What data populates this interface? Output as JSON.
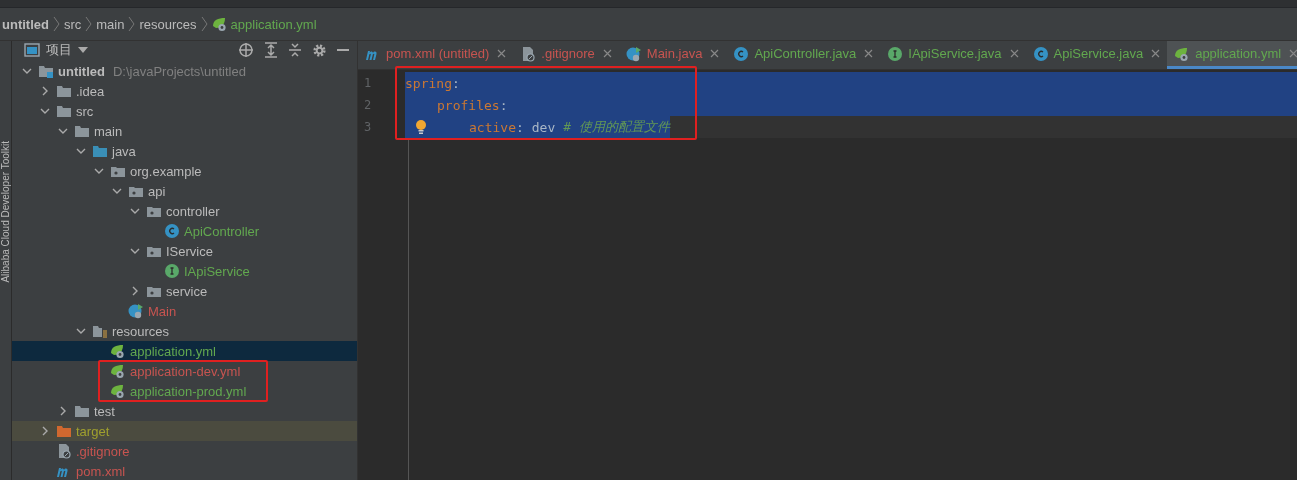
{
  "breadcrumb": [
    {
      "label": "untitled",
      "kind": "project"
    },
    {
      "label": "src",
      "kind": "folder"
    },
    {
      "label": "main",
      "kind": "folder"
    },
    {
      "label": "resources",
      "kind": "folder"
    },
    {
      "label": "application.yml",
      "kind": "spring-config"
    }
  ],
  "side_strip": {
    "label": "Alibaba Cloud Developer Toolkit"
  },
  "project_panel": {
    "title": "项目",
    "tree": [
      {
        "name": "untitled",
        "path": "D:\\javaProjects\\untitled",
        "kind": "module",
        "color": "#bbbbbb",
        "expanded": true,
        "selected": false,
        "children": [
          {
            "name": ".idea",
            "kind": "folder",
            "color": "#bbbbbb",
            "expanded": false,
            "selected": false
          },
          {
            "name": "src",
            "kind": "folder",
            "color": "#bbbbbb",
            "expanded": true,
            "selected": false,
            "children": [
              {
                "name": "main",
                "kind": "folder",
                "color": "#bbbbbb",
                "expanded": true,
                "selected": false,
                "children": [
                  {
                    "name": "java",
                    "kind": "source-folder",
                    "color": "#bbbbbb",
                    "expanded": true,
                    "selected": false,
                    "children": [
                      {
                        "name": "org.example",
                        "kind": "package",
                        "color": "#bbbbbb",
                        "expanded": true,
                        "selected": false,
                        "children": [
                          {
                            "name": "api",
                            "kind": "package",
                            "color": "#bbbbbb",
                            "expanded": true,
                            "selected": false,
                            "children": [
                              {
                                "name": "controller",
                                "kind": "package",
                                "color": "#bbbbbb",
                                "expanded": true,
                                "selected": false,
                                "children": [
                                  {
                                    "name": "ApiController",
                                    "kind": "class",
                                    "color": "#62a84f",
                                    "selected": false
                                  }
                                ]
                              },
                              {
                                "name": "IService",
                                "kind": "package",
                                "color": "#bbbbbb",
                                "expanded": true,
                                "selected": false,
                                "children": [
                                  {
                                    "name": "IApiService",
                                    "kind": "interface",
                                    "color": "#62a84f",
                                    "selected": false
                                  }
                                ]
                              },
                              {
                                "name": "service",
                                "kind": "package",
                                "color": "#bbbbbb",
                                "expanded": false,
                                "selected": false
                              }
                            ]
                          },
                          {
                            "name": "Main",
                            "kind": "main",
                            "color": "#c75450",
                            "selected": false
                          }
                        ]
                      }
                    ]
                  },
                  {
                    "name": "resources",
                    "kind": "resources-folder",
                    "color": "#bbbbbb",
                    "expanded": true,
                    "selected": false,
                    "children": [
                      {
                        "name": "application.yml",
                        "kind": "spring-config",
                        "color": "#62a84f",
                        "selected": true,
                        "marked": false
                      },
                      {
                        "name": "application-dev.yml",
                        "kind": "spring-config",
                        "color": "#c75450",
                        "selected": false,
                        "marked": true
                      },
                      {
                        "name": "application-prod.yml",
                        "kind": "spring-config",
                        "color": "#62a84f",
                        "selected": false,
                        "marked": true
                      }
                    ]
                  }
                ]
              },
              {
                "name": "test",
                "kind": "folder",
                "color": "#bbbbbb",
                "expanded": false,
                "selected": false
              }
            ]
          },
          {
            "name": "target",
            "kind": "excluded-folder",
            "color": "#a0a02e",
            "expanded": false,
            "selected": false
          },
          {
            "name": ".gitignore",
            "kind": "gitignore",
            "color": "#c75450",
            "selected": false
          },
          {
            "name": "pom.xml",
            "kind": "maven",
            "color": "#c75450",
            "selected": false
          }
        ]
      }
    ]
  },
  "tabs": [
    {
      "label": "pom.xml (untitled)",
      "kind": "maven",
      "color": "#c75450",
      "selected": false
    },
    {
      "label": ".gitignore",
      "kind": "gitignore",
      "color": "#c75450",
      "selected": false
    },
    {
      "label": "Main.java",
      "kind": "main",
      "color": "#c75450",
      "selected": false
    },
    {
      "label": "ApiController.java",
      "kind": "class",
      "color": "#62a84f",
      "selected": false
    },
    {
      "label": "IApiService.java",
      "kind": "interface",
      "color": "#62a84f",
      "selected": false
    },
    {
      "label": "ApiService.java",
      "kind": "class",
      "color": "#62a84f",
      "selected": false
    },
    {
      "label": "application.yml",
      "kind": "spring-config",
      "color": "#62a84f",
      "selected": true
    }
  ],
  "editor": {
    "marked": true,
    "lines": [
      {
        "number": "1",
        "current": false,
        "selected": true,
        "tokens": [
          {
            "kind": "key",
            "text": "spring"
          },
          {
            "kind": "punct",
            "text": ":"
          }
        ],
        "children": [
          {
            "number": "2",
            "current": false,
            "selected": true,
            "tokens": [
              {
                "kind": "key",
                "text": "profiles"
              },
              {
                "kind": "punct",
                "text": ":"
              }
            ],
            "children": [
              {
                "number": "3",
                "current": true,
                "selected": true,
                "tokens": [
                  {
                    "kind": "key",
                    "text": "active"
                  },
                  {
                    "kind": "punct",
                    "text": ":"
                  },
                  {
                    "kind": "value",
                    "text": "dev"
                  },
                  {
                    "kind": "comment",
                    "text": "# 使用的配置文件"
                  }
                ]
              }
            ]
          }
        ]
      }
    ]
  }
}
